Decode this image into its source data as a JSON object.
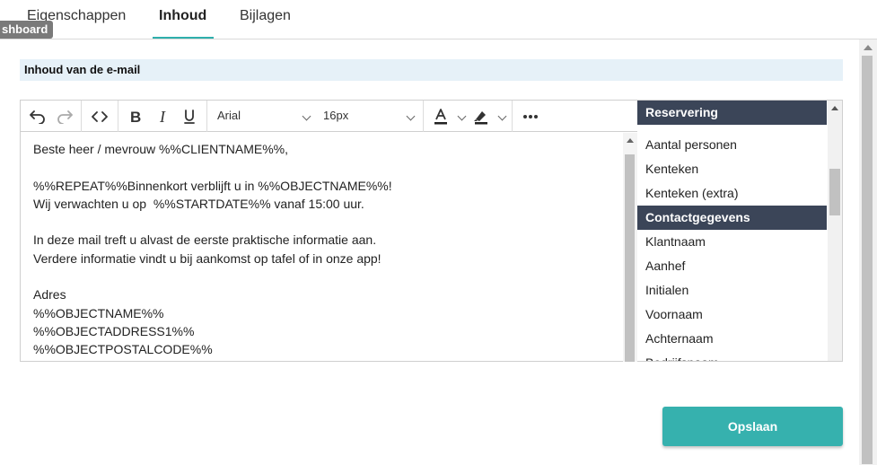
{
  "tabs": [
    {
      "label": "Eigenschappen"
    },
    {
      "label": "Inhoud"
    },
    {
      "label": "Bijlagen"
    }
  ],
  "tooltip": "shboard",
  "section": {
    "title": "Inhoud van de e-mail"
  },
  "toolbar": {
    "font_family": "Arial",
    "font_size": "16px"
  },
  "editor": {
    "lines": [
      "Beste heer / mevrouw %%CLIENTNAME%%,",
      "",
      "%%REPEAT%%Binnenkort verblijft u in %%OBJECTNAME%%!",
      "Wij verwachten u op  %%STARTDATE%% vanaf 15:00 uur.",
      "",
      "In deze mail treft u alvast de eerste praktische informatie aan.",
      "Verdere informatie vindt u bij aankomst op tafel of in onze app!",
      "",
      "Adres",
      "%%OBJECTNAME%%",
      "%%OBJECTADDRESS1%%",
      "%%OBJECTPOSTALCODE%%"
    ]
  },
  "placeholders": {
    "cat1": "Reservering",
    "cat1_items": [
      "Aantal personen",
      "Kenteken",
      "Kenteken (extra)"
    ],
    "cat2": "Contactgegevens",
    "cat2_items": [
      "Klantnaam",
      "Aanhef",
      "Initialen",
      "Voornaam",
      "Achternaam",
      "Bedrijfsnaam"
    ]
  },
  "save_label": "Opslaan",
  "colors": {
    "accent": "#36b1ae",
    "category_bg": "#3b4558",
    "section_bg": "#e6f1f8"
  }
}
